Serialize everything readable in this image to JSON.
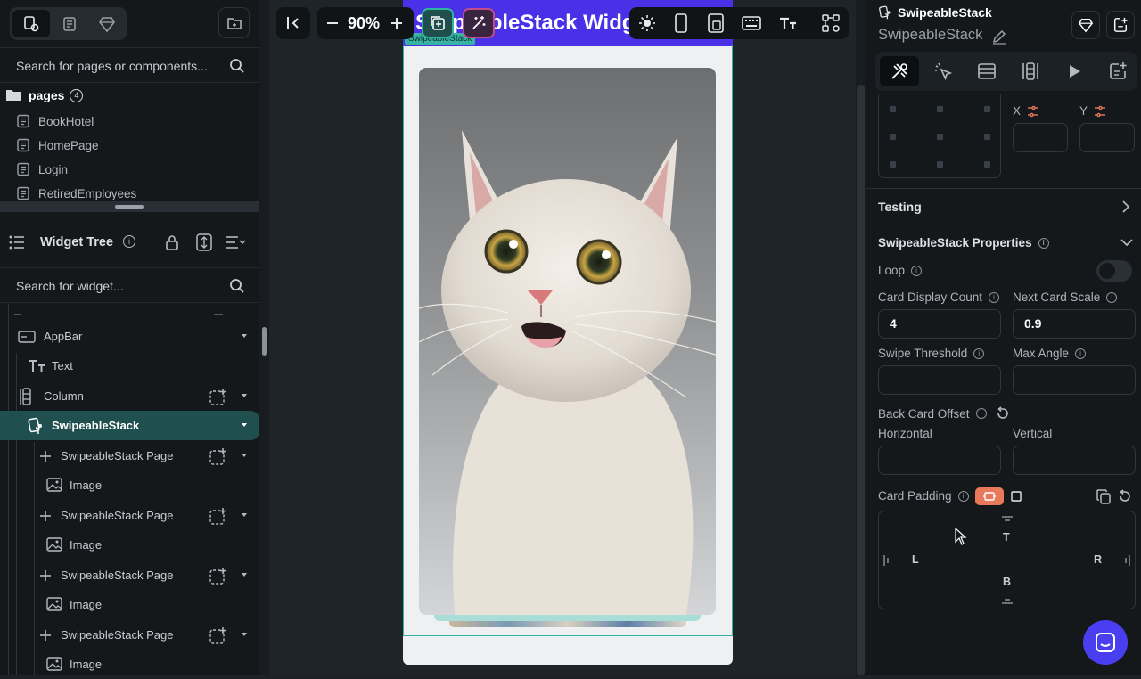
{
  "left": {
    "search_pages_placeholder": "Search for pages or components...",
    "pages_label": "pages",
    "pages_count": "4",
    "pages": [
      "BookHotel",
      "HomePage",
      "Login",
      "RetiredEmployees"
    ],
    "widget_tree_title": "Widget Tree",
    "search_widget_placeholder": "Search for widget...",
    "tree": {
      "appbar": "AppBar",
      "text": "Text",
      "column": "Column",
      "swipeable": "SwipeableStack",
      "page1": "SwipeableStack Page",
      "image1": "Image",
      "page2": "SwipeableStack Page",
      "image2": "Image",
      "page3": "SwipeableStack Page",
      "image3": "Image",
      "page4": "SwipeableStack Page",
      "image4": "Image"
    }
  },
  "canvas": {
    "zoom": "90%",
    "appbar_title": "SwipeableStack Widget",
    "selection_tag": "SwipeableStack"
  },
  "right": {
    "widget_type": "SwipeableStack",
    "widget_name": "SwipeableStack",
    "x_label": "X",
    "y_label": "Y",
    "testing_label": "Testing",
    "properties_title": "SwipeableStack Properties",
    "loop_label": "Loop",
    "card_display_count_label": "Card Display Count",
    "card_display_count_value": "4",
    "next_card_scale_label": "Next Card Scale",
    "next_card_scale_value": "0.9",
    "swipe_threshold_label": "Swipe Threshold",
    "max_angle_label": "Max Angle",
    "back_card_offset_label": "Back Card Offset",
    "horizontal_label": "Horizontal",
    "vertical_label": "Vertical",
    "card_padding_label": "Card Padding",
    "pad_t": "T",
    "pad_l": "L",
    "pad_r": "R",
    "pad_b": "B"
  },
  "colors": {
    "accent_teal": "#2fb3a3",
    "appbar_purple": "#4a31e8",
    "selected_row": "#1f4f4e",
    "padding_toggle": "#e8795a",
    "chat_button": "#4a3ff0"
  }
}
